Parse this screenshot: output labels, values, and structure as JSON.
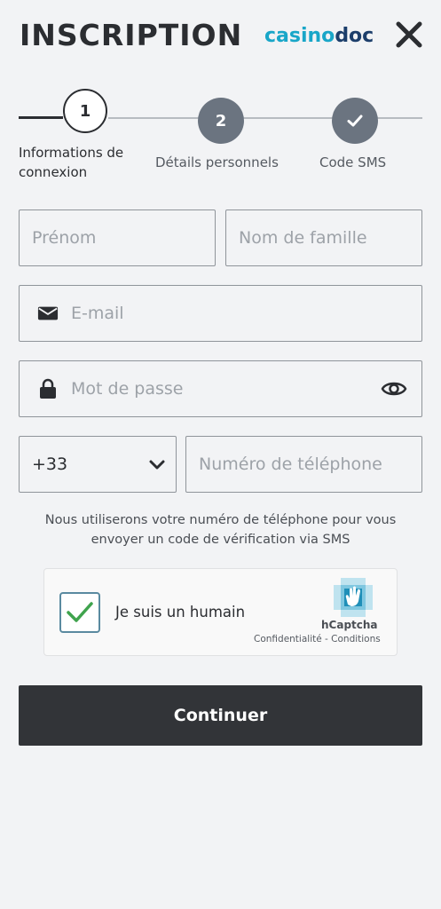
{
  "header": {
    "title": "INSCRIPTION",
    "logo_part1": "casino",
    "logo_part2": "doc",
    "close_icon": "close-icon"
  },
  "stepper": {
    "steps": [
      {
        "number": "1",
        "label_line1": "Informations de",
        "label_line2": "connexion",
        "state": "active"
      },
      {
        "number": "2",
        "label": "Détails personnels",
        "state": "pending"
      },
      {
        "icon": "checkmark-icon",
        "label": "Code SMS",
        "state": "pending"
      }
    ]
  },
  "form": {
    "first_name_placeholder": "Prénom",
    "last_name_placeholder": "Nom de famille",
    "email_placeholder": "E-mail",
    "password_placeholder": "Mot de passe",
    "phone_code": "+33",
    "phone_placeholder": "Numéro de téléphone",
    "icons": {
      "email": "envelope-icon",
      "password": "lock-icon",
      "show_password": "eye-icon",
      "dropdown": "chevron-down-icon"
    }
  },
  "sms_note": {
    "line1": "Nous utiliserons votre numéro de téléphone pour vous",
    "line2": "envoyer un code de vérification via SMS"
  },
  "captcha": {
    "label": "Je suis un humain",
    "checked": true,
    "brand": "hCaptcha",
    "privacy": "Confidentialité",
    "separator": " - ",
    "terms": "Conditions"
  },
  "continue_label": "Continuer",
  "colors": {
    "background": "#f2f3f5",
    "text": "#2b2d31",
    "step_active_border": "#2b2d31",
    "step_pending": "#6b7480",
    "button": "#323438",
    "logo_primary": "#19a6c8",
    "logo_secondary": "#1c3e6b",
    "captcha_check": "#3fa34d"
  }
}
